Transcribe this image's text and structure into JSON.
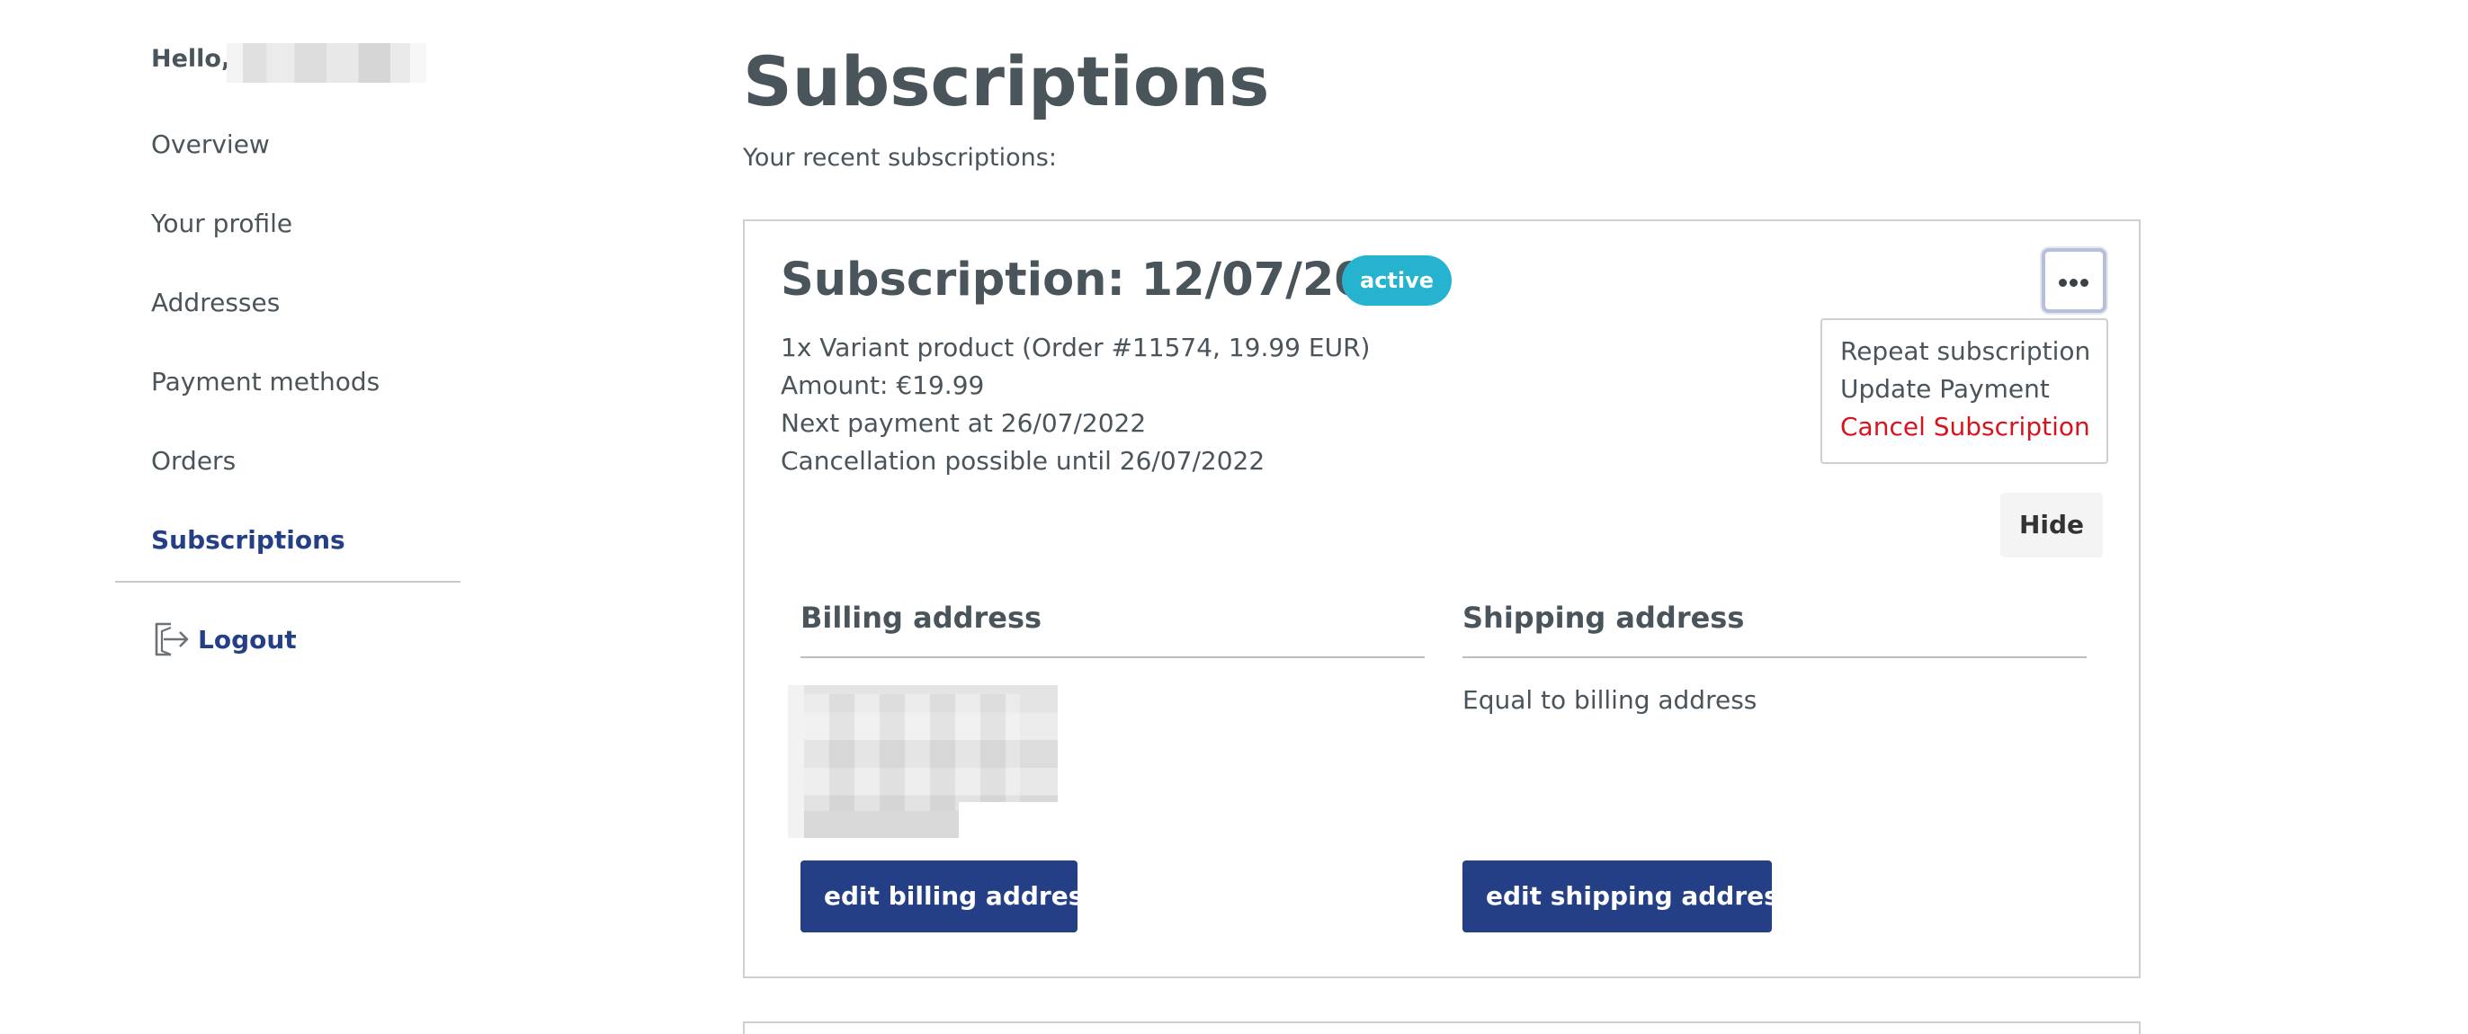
{
  "sidebar": {
    "greeting": "Hello,",
    "nav": [
      {
        "label": "Overview",
        "active": false
      },
      {
        "label": "Your profile",
        "active": false
      },
      {
        "label": "Addresses",
        "active": false
      },
      {
        "label": "Payment methods",
        "active": false
      },
      {
        "label": "Orders",
        "active": false
      },
      {
        "label": "Subscriptions",
        "active": true
      }
    ],
    "logout_label": "Logout",
    "logout_icon": "logout-icon"
  },
  "main": {
    "title": "Subscriptions",
    "subtitle": "Your recent subscriptions:",
    "subscription": {
      "title": "Subscription: 12/07/2022",
      "status": "active",
      "details": [
        "1x Variant product (Order #11574, 19.99 EUR)",
        "Amount: €19.99",
        "Next payment at 26/07/2022",
        "Cancellation possible until 26/07/2022"
      ],
      "menu": {
        "icon": "more-horizontal-icon",
        "items": [
          {
            "label": "Repeat subscription",
            "danger": false
          },
          {
            "label": "Update Payment",
            "danger": false
          },
          {
            "label": "Cancel Subscription",
            "danger": true
          }
        ]
      },
      "hide_label": "Hide",
      "billing": {
        "heading": "Billing address",
        "button_label": "edit billing address"
      },
      "shipping": {
        "heading": "Shipping address",
        "text": "Equal to billing address",
        "button_label": "edit shipping address"
      }
    }
  },
  "colors": {
    "text": "#4a545b",
    "primary": "#243f86",
    "badge": "#26b3d0",
    "danger": "#d7141e",
    "border": "#cfcfcf"
  }
}
